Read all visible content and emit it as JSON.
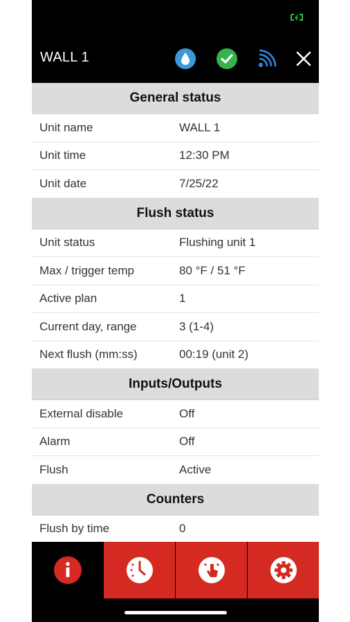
{
  "header": {
    "title": "WALL 1",
    "icons": [
      "water-drop-icon",
      "check-circle-icon",
      "signal-icon",
      "close-icon"
    ]
  },
  "colors": {
    "accent_red": "#d42a21",
    "water_blue": "#3a9ad9",
    "check_green": "#34b34a",
    "signal_blue": "#2e7fd1",
    "battery_green": "#29c53a"
  },
  "sections": {
    "general": {
      "title": "General status",
      "rows": [
        {
          "label": "Unit name",
          "value": "WALL 1"
        },
        {
          "label": "Unit time",
          "value": "12:30 PM"
        },
        {
          "label": "Unit date",
          "value": "7/25/22"
        }
      ]
    },
    "flush": {
      "title": "Flush status",
      "rows": [
        {
          "label": "Unit status",
          "value": "Flushing unit 1"
        },
        {
          "label": "Max / trigger temp",
          "value": "80 °F / 51 °F"
        },
        {
          "label": "Active plan",
          "value": "1"
        },
        {
          "label": "Current day, range",
          "value": "3 (1-4)"
        },
        {
          "label": "Next flush (mm:ss)",
          "value": "00:19 (unit 2)"
        }
      ]
    },
    "io": {
      "title": "Inputs/Outputs",
      "rows": [
        {
          "label": "External disable",
          "value": "Off"
        },
        {
          "label": "Alarm",
          "value": "Off"
        },
        {
          "label": "Flush",
          "value": "Active"
        }
      ]
    },
    "counters": {
      "title": "Counters",
      "rows": [
        {
          "label": "Flush by time",
          "value": "0"
        }
      ]
    }
  },
  "tabbar": {
    "tabs": [
      "info-icon",
      "clock-icon",
      "touch-icon",
      "gear-icon"
    ],
    "active_index": 0
  }
}
